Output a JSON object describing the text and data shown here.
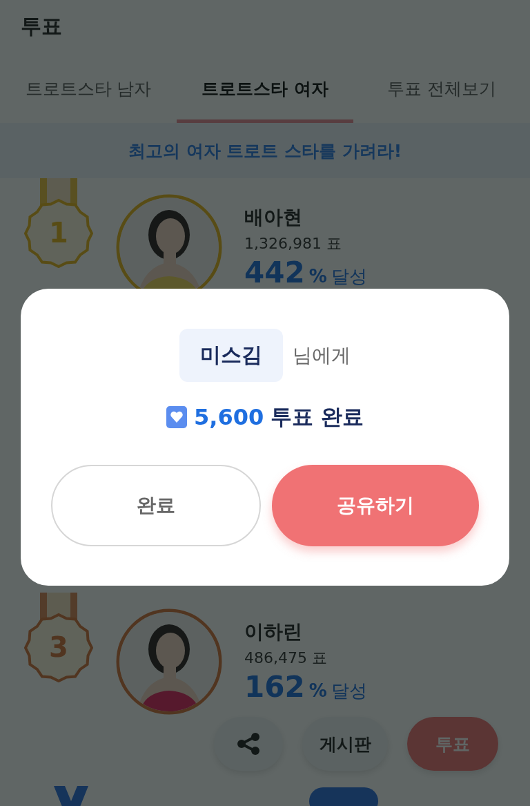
{
  "header": {
    "title": "투표"
  },
  "tabs": [
    {
      "label": "트로트스타 남자",
      "selected": false
    },
    {
      "label": "트로트스타 여자",
      "selected": true
    },
    {
      "label": "투표 전체보기",
      "selected": false
    }
  ],
  "banner": "최고의 여자 트로트 스타를 가려라!",
  "entries": [
    {
      "rank": "1",
      "kind": "gold",
      "name": "배아현",
      "votes": "1,326,981 표",
      "percent": "442",
      "unit": "%",
      "achieved": "달성"
    },
    {
      "rank": "3",
      "kind": "bronze",
      "name": "이하린",
      "votes": "486,475 표",
      "percent": "162",
      "unit": "%",
      "achieved": "달성",
      "buttons": [
        {
          "kind": "share"
        },
        {
          "kind": "plain",
          "label": "게시판"
        },
        {
          "kind": "primary",
          "label": "투표"
        }
      ]
    }
  ],
  "modal": {
    "recipient": "미스김",
    "recipient_suffix": "님에게",
    "count": "5,600",
    "result": "투표 완료",
    "buttons": [
      {
        "kind": "outline",
        "label": "완료"
      },
      {
        "kind": "primary",
        "label": "공유하기"
      }
    ]
  }
}
